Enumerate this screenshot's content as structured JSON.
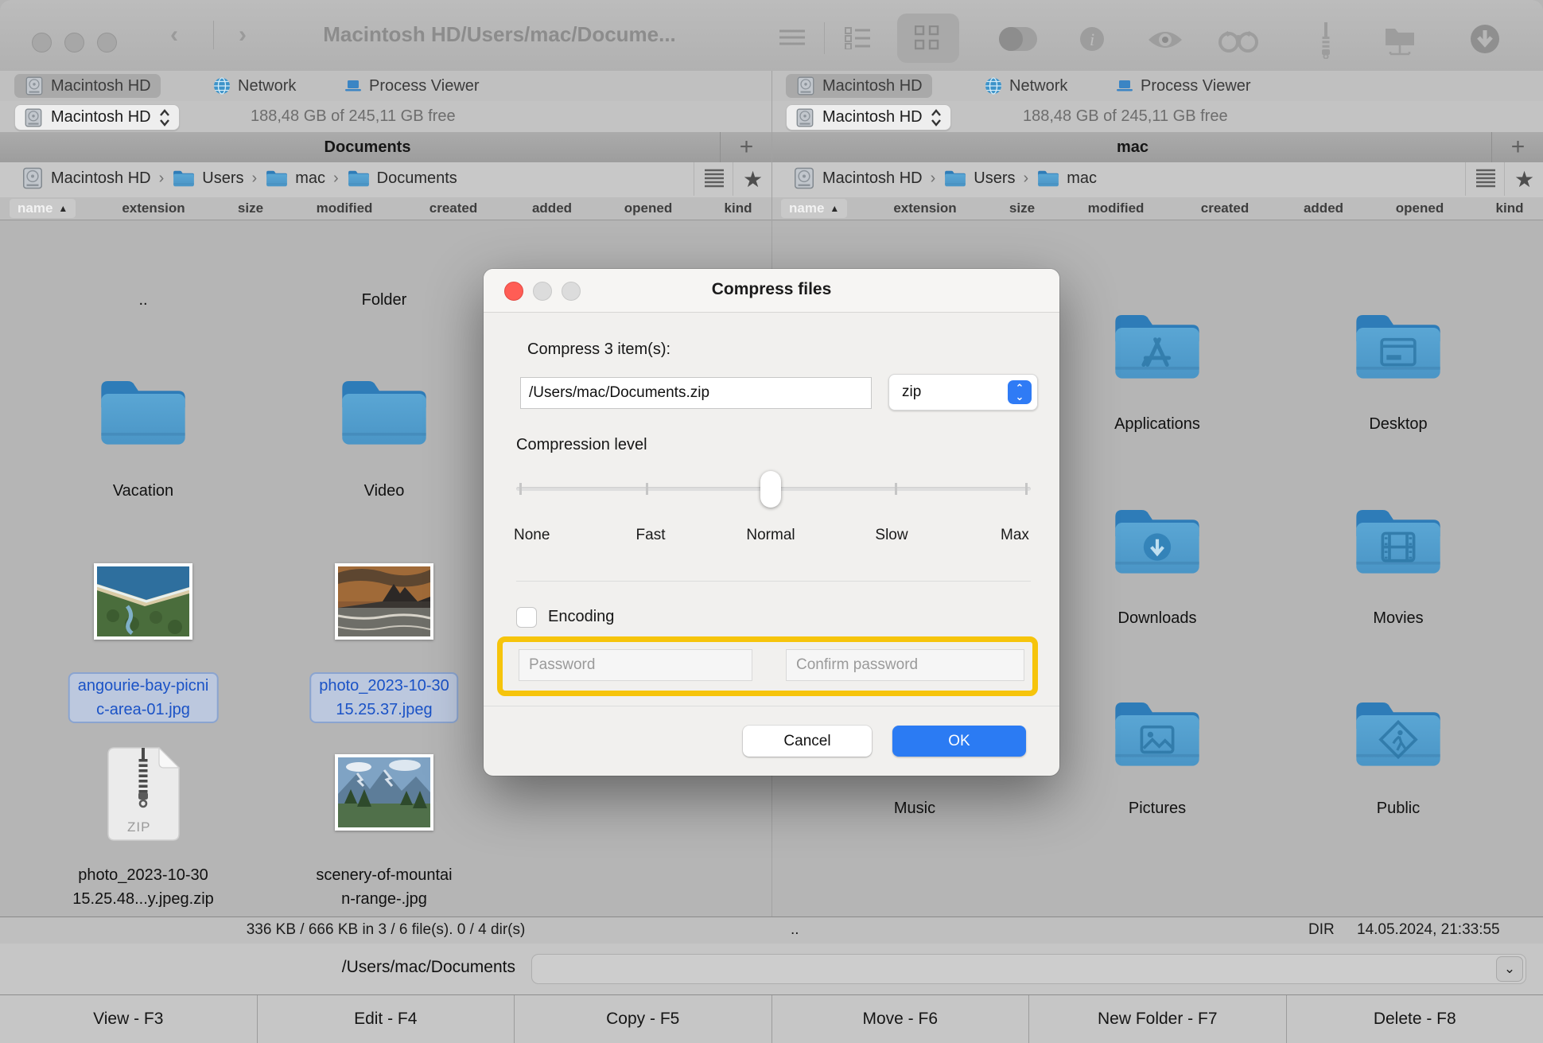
{
  "window": {
    "title": "Macintosh HD/Users/mac/Docume..."
  },
  "colors": {
    "accent_blue": "#2b7bf3",
    "highlight_yellow": "#f6c40b",
    "folder_blue": "#4f9fd0",
    "selection_text": "#1a52c6"
  },
  "panes": {
    "left": {
      "tabs": [
        {
          "label": "Macintosh HD"
        },
        {
          "label": "Network"
        },
        {
          "label": "Process Viewer"
        }
      ],
      "drive": {
        "name": "Macintosh HD",
        "free": "188,48 GB of 245,11 GB free"
      },
      "title": "Documents",
      "add_tab": "+",
      "crumbs": [
        {
          "label": "Macintosh HD"
        },
        {
          "label": "Users"
        },
        {
          "label": "mac"
        },
        {
          "label": "Documents"
        }
      ],
      "crumb_sep": "›",
      "columns": [
        {
          "label": "name"
        },
        {
          "label": "extension"
        },
        {
          "label": "size"
        },
        {
          "label": "modified"
        },
        {
          "label": "created"
        },
        {
          "label": "added"
        },
        {
          "label": "opened"
        },
        {
          "label": "kind"
        }
      ],
      "items": [
        {
          "line1": "..",
          "line2": "",
          "kind": "parent"
        },
        {
          "line1": "Folder",
          "line2": "",
          "kind": "text"
        },
        {
          "line1": "Vacation",
          "line2": "",
          "kind": "folder"
        },
        {
          "line1": "Video",
          "line2": "",
          "kind": "folder"
        },
        {
          "line1": "angourie-bay-picni",
          "line2": "c-area-01.jpg",
          "kind": "image",
          "selected": true
        },
        {
          "line1": "photo_2023-10-30",
          "line2": "15.25.37.jpeg",
          "kind": "image",
          "selected": true
        },
        {
          "line1": "photo_2023-10-30",
          "line2": "15.25.48...y.jpeg.zip",
          "kind": "zip"
        },
        {
          "line1": "scenery-of-mountai",
          "line2": "n-range-.jpg",
          "kind": "image"
        }
      ],
      "zip_badge": "ZIP",
      "status": "336 KB / 666 KB in 3 / 6 file(s). 0 / 4 dir(s)"
    },
    "right": {
      "tabs": [
        {
          "label": "Macintosh HD"
        },
        {
          "label": "Network"
        },
        {
          "label": "Process Viewer"
        }
      ],
      "drive": {
        "name": "Macintosh HD",
        "free": "188,48 GB of 245,11 GB free"
      },
      "title": "mac",
      "add_tab": "+",
      "crumbs": [
        {
          "label": "Macintosh HD"
        },
        {
          "label": "Users"
        },
        {
          "label": "mac"
        }
      ],
      "crumb_sep": "›",
      "columns": [
        {
          "label": "name"
        },
        {
          "label": "extension"
        },
        {
          "label": "size"
        },
        {
          "label": "modified"
        },
        {
          "label": "created"
        },
        {
          "label": "added"
        },
        {
          "label": "opened"
        },
        {
          "label": "kind"
        }
      ],
      "items": [
        {
          "label": "Applications",
          "glyph": "appstore"
        },
        {
          "label": "Desktop",
          "glyph": "desktop"
        },
        {
          "label": "Downloads",
          "glyph": "download"
        },
        {
          "label": "Movies",
          "glyph": "movies"
        },
        {
          "label": "Music",
          "glyph": "music-hidden"
        },
        {
          "label": "Pictures",
          "glyph": "pictures"
        },
        {
          "label": "Public",
          "glyph": "public"
        }
      ],
      "status": {
        "up": "..",
        "kind": "DIR",
        "date": "14.05.2024, 21:33:55"
      }
    }
  },
  "dialog": {
    "title": "Compress files",
    "prompt": "Compress 3 item(s):",
    "filename": "/Users/mac/Documents.zip",
    "format": "zip",
    "level_label": "Compression level",
    "levels": [
      {
        "label": "None"
      },
      {
        "label": "Fast"
      },
      {
        "label": "Normal"
      },
      {
        "label": "Slow"
      },
      {
        "label": "Max"
      }
    ],
    "selected_level": "Normal",
    "encoding_label": "Encoding",
    "password_placeholder": "Password",
    "confirm_placeholder": "Confirm password",
    "cancel_label": "Cancel",
    "ok_label": "OK"
  },
  "pathbar": {
    "path": "/Users/mac/Documents"
  },
  "fnbar": {
    "buttons": [
      {
        "label": "View - F3"
      },
      {
        "label": "Edit - F4"
      },
      {
        "label": "Copy - F5"
      },
      {
        "label": "Move - F6"
      },
      {
        "label": "New Folder - F7"
      },
      {
        "label": "Delete - F8"
      }
    ]
  }
}
